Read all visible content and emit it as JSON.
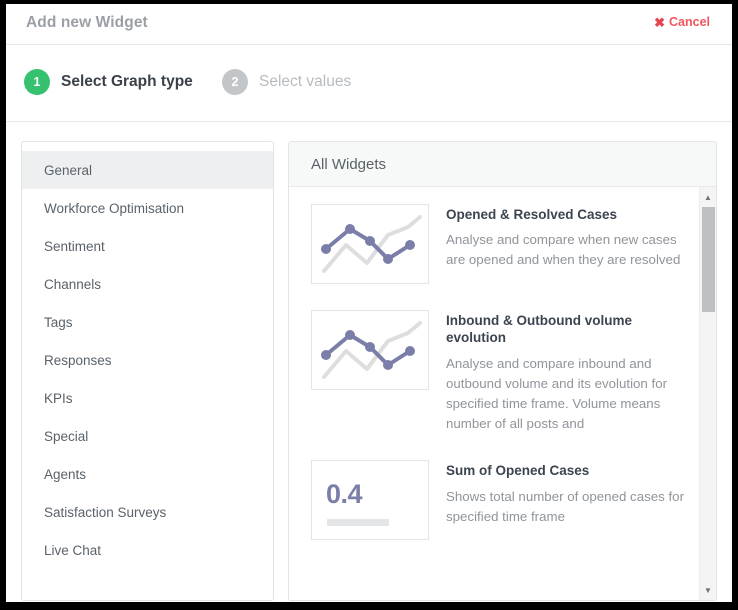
{
  "dialog": {
    "title": "Add new Widget",
    "cancel_label": "Cancel",
    "cancel_icon": "close-x-icon"
  },
  "steps": [
    {
      "number": "1",
      "label": "Select Graph type",
      "state": "active",
      "color": "#35c16d"
    },
    {
      "number": "2",
      "label": "Select values",
      "state": "inactive",
      "color": "#c3c6c9"
    }
  ],
  "categories": {
    "items": [
      {
        "label": "General",
        "active": true
      },
      {
        "label": "Workforce Optimisation",
        "active": false
      },
      {
        "label": "Sentiment",
        "active": false
      },
      {
        "label": "Channels",
        "active": false
      },
      {
        "label": "Tags",
        "active": false
      },
      {
        "label": "Responses",
        "active": false
      },
      {
        "label": "KPIs",
        "active": false
      },
      {
        "label": "Special",
        "active": false
      },
      {
        "label": "Agents",
        "active": false
      },
      {
        "label": "Satisfaction Surveys",
        "active": false
      },
      {
        "label": "Live Chat",
        "active": false
      }
    ]
  },
  "widgets_panel": {
    "header": "All Widgets",
    "items": [
      {
        "title": "Opened & Resolved Cases",
        "description": "Analyse and compare when new cases are opened and when they are resolved",
        "thumbnail": "line-chart-icon"
      },
      {
        "title": "Inbound & Outbound volume evolution",
        "description": "Analyse and compare inbound and outbound volume and its evolution for specified time frame. Volume means number of all posts and",
        "thumbnail": "line-chart-icon"
      },
      {
        "title": "Sum of Opened Cases",
        "description": "Shows total number of opened cases for specified time frame",
        "thumbnail": "big-number-icon",
        "thumbnail_value": "0.4"
      }
    ],
    "scrollbar": {
      "up_arrow": "chevron-up-icon",
      "down_arrow": "chevron-down-icon"
    }
  },
  "colors": {
    "accent_green": "#35c16d",
    "cancel_red": "#f2565f",
    "chart_purple": "#7b7ea8",
    "chart_gray": "#dedede"
  }
}
